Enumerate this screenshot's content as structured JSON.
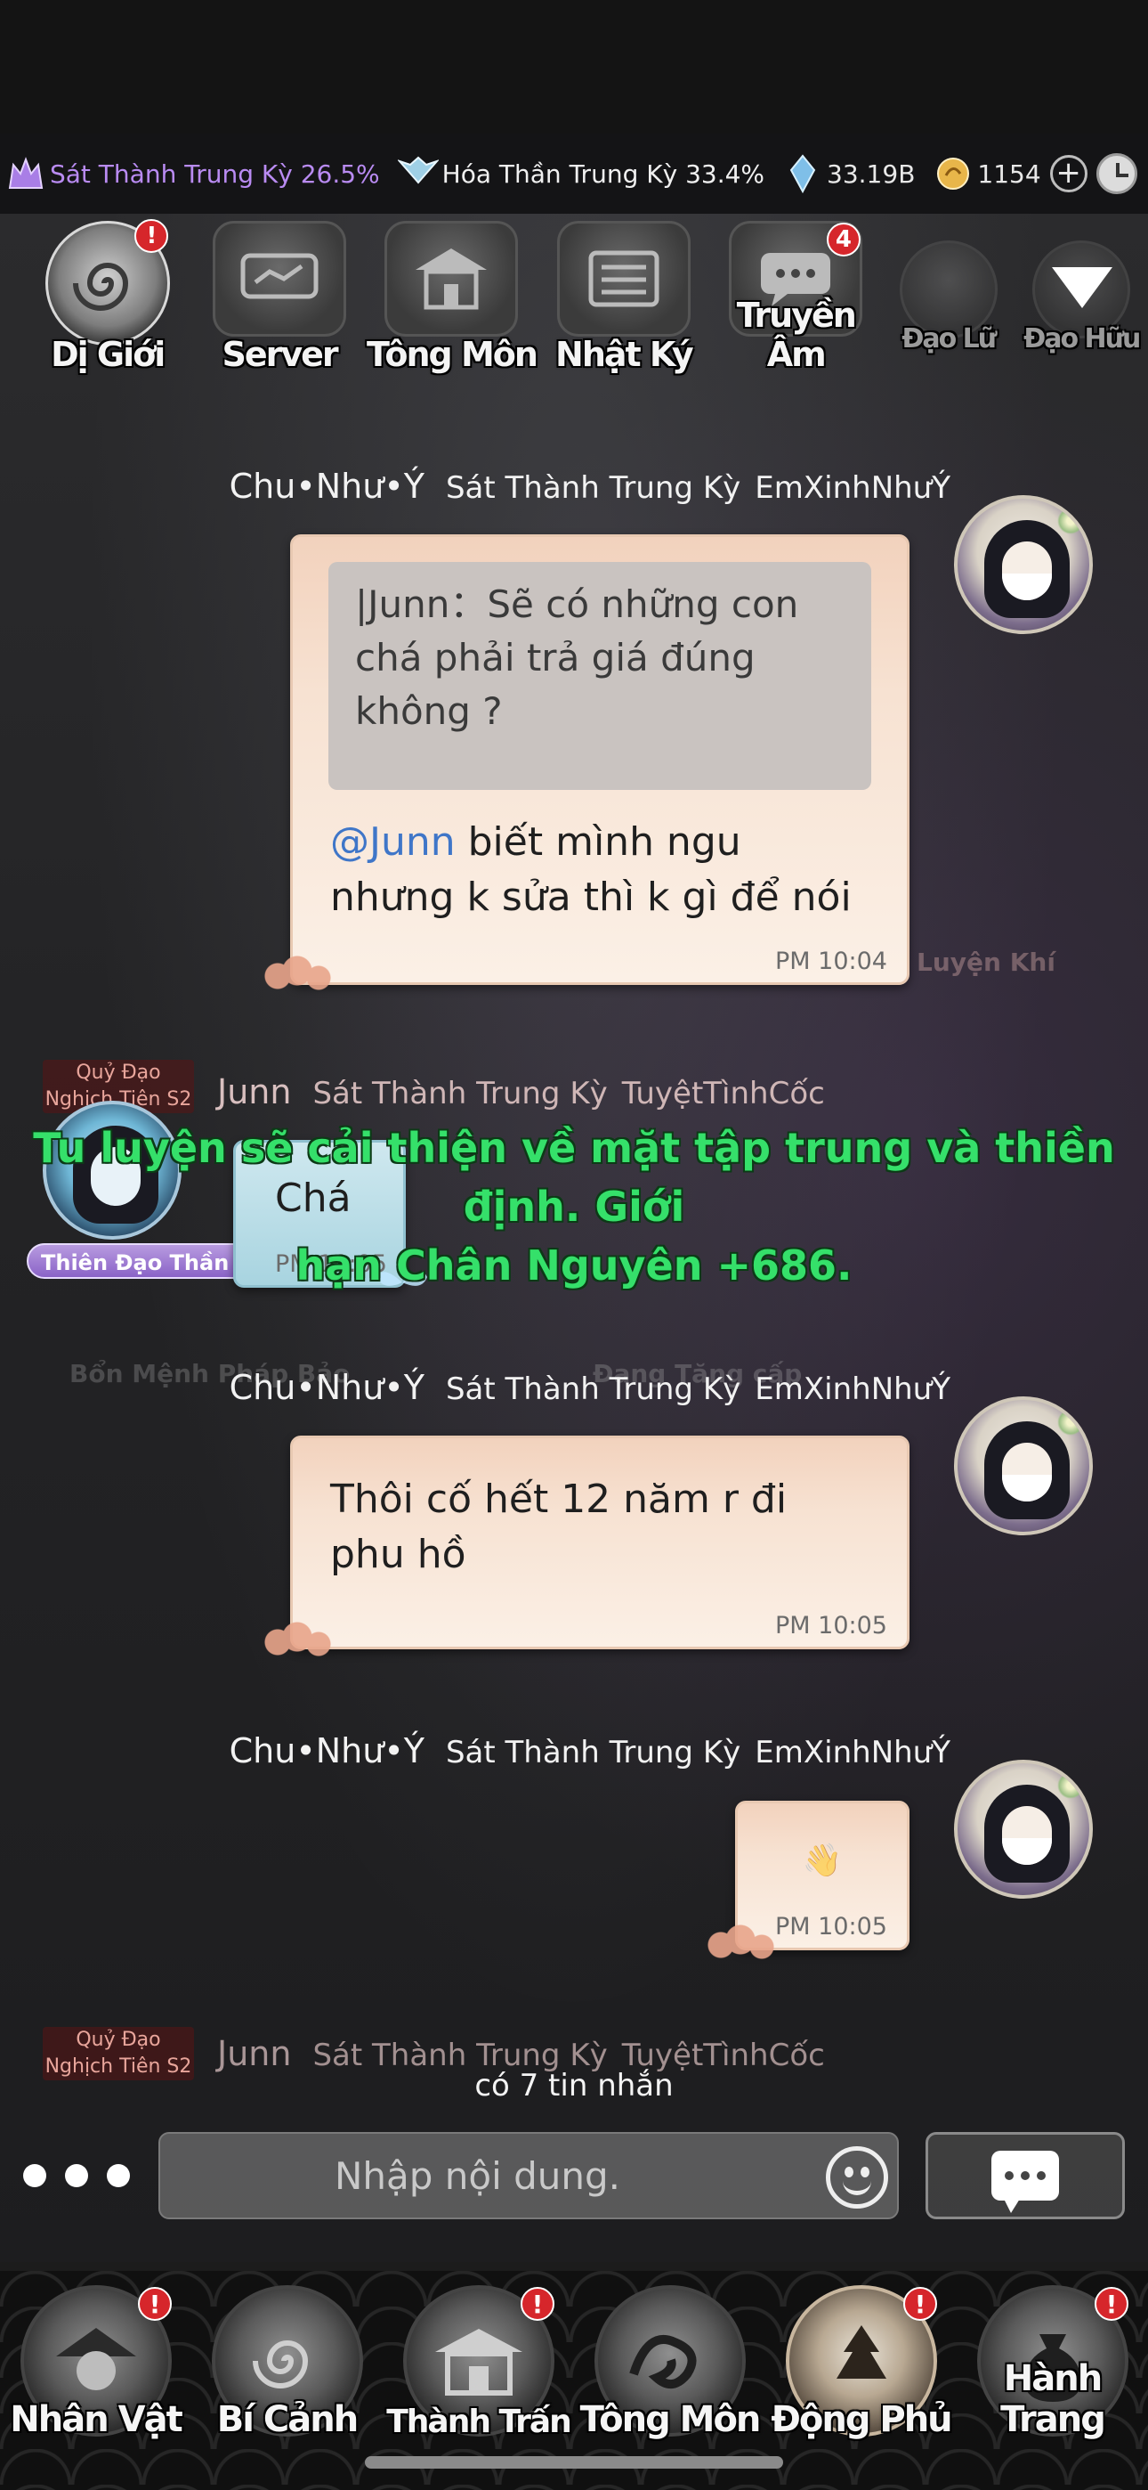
{
  "status_bar": {
    "realm_primary": "Sát Thành Trung Kỳ 26.5%",
    "realm_secondary": "Hóa Thần Trung Kỳ 33.4%",
    "spirit_stones": "33.19B",
    "gold": "1154",
    "plus_label": "+"
  },
  "channels": [
    {
      "label": "Dị Giới",
      "badge": "!"
    },
    {
      "label": "Server"
    },
    {
      "label": "Tông Môn"
    },
    {
      "label": "Nhật Ký"
    },
    {
      "label": "Truyền Âm",
      "badge": "4"
    },
    {
      "label": "Đạo Lữ"
    },
    {
      "label": "Đạo Hữu"
    }
  ],
  "messages": [
    {
      "sender": "Chu•Như•Ý",
      "realm": "Sát Thành Trung Kỳ",
      "clan": "EmXinhNhưÝ",
      "quote": "|Junn：Sẽ có những con chá phải trả giá đúng không ?",
      "mention": "@Junn",
      "text": " biết mình ngu nhưng k sửa thì k gì để nói",
      "time": "PM 10:04"
    },
    {
      "sender": "Junn",
      "realm": "Sát Thành Trung Kỳ",
      "clan": "TuyệtTìnhCốc",
      "rank": "Quỷ Đạo Nghịch Tiên S2",
      "title": "Thiên Đạo Thần Quân",
      "text": "Chá",
      "time": "PM 10:05"
    },
    {
      "sender": "Chu•Như•Ý",
      "realm": "Sát Thành Trung Kỳ",
      "clan": "EmXinhNhưÝ",
      "text": "Thôi cố hết 12 năm r đi phu hồ",
      "time": "PM 10:05"
    },
    {
      "sender": "Chu•Như•Ý",
      "realm": "Sát Thành Trung Kỳ",
      "clan": "EmXinhNhưÝ",
      "text": "👋",
      "time": "PM 10:05"
    },
    {
      "sender": "Junn",
      "realm": "Sát Thành Trung Kỳ",
      "clan": "TuyệtTìnhCốc",
      "rank": "Quỷ Đạo Nghịch Tiên S2"
    }
  ],
  "system_notice": {
    "line1": "Tu luyện sẽ cải thiện về mặt tập trung và thiền định. Giới",
    "line2": "hạn Chân Nguyên +686."
  },
  "background_labels": {
    "luyen_khi": "Luyện Khí",
    "ban_menh": "Bổn Mệnh Pháp Bảo",
    "dang_tang_cap": "Đang Tăng cấp"
  },
  "new_messages": "có 7 tin nhắn",
  "input": {
    "placeholder": "Nhập nội dung."
  },
  "bottom_nav": [
    {
      "label": "Nhân Vật",
      "badge": "!"
    },
    {
      "label": "Bí Cảnh"
    },
    {
      "label": "Thành Trấn",
      "badge": "!"
    },
    {
      "label": "Tông Môn"
    },
    {
      "label": "Động Phủ",
      "badge": "!",
      "active": true
    },
    {
      "label": "Hành Trang",
      "badge": "!"
    }
  ],
  "colors": {
    "realm_purple": "#b98bf2",
    "mention_blue": "#3f76c8",
    "system_green": "#35e06a",
    "badge_red": "#d6262b",
    "bubble_peach": "#f7e2d2"
  }
}
